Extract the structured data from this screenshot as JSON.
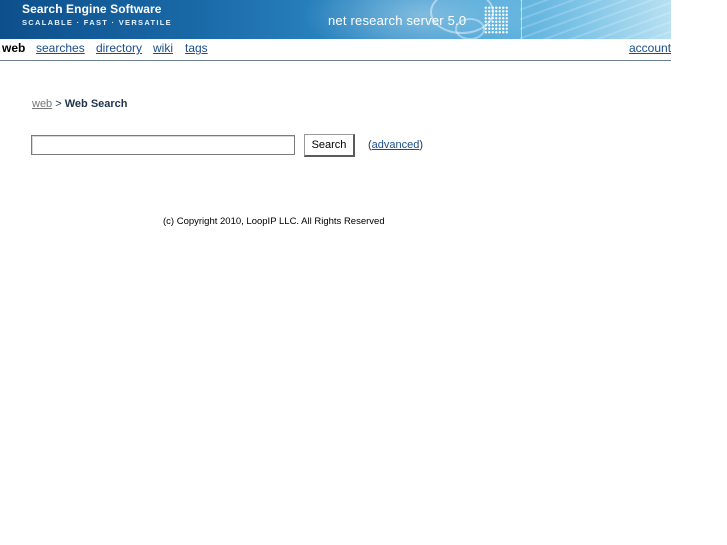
{
  "banner": {
    "title": "Search Engine Software",
    "tagline": "SCALABLE · FAST · VERSATILE",
    "product": "net research server 5.0"
  },
  "nav": {
    "active": "web",
    "items": [
      {
        "label": "searches"
      },
      {
        "label": "directory"
      },
      {
        "label": "wiki"
      },
      {
        "label": "tags"
      }
    ],
    "account": "account"
  },
  "breadcrumb": {
    "root": "web",
    "separator": ">",
    "current": "Web Search"
  },
  "search": {
    "value": "",
    "button_label": "Search",
    "advanced_open": "(",
    "advanced_label": "advanced",
    "advanced_close": ")"
  },
  "footer": {
    "copyright": "(c) Copyright 2010, LoopIP LLC. All Rights Reserved"
  },
  "colors": {
    "link": "#1a4d8c",
    "banner": "#1a6aa8",
    "nav_border": "#6b7f95"
  }
}
